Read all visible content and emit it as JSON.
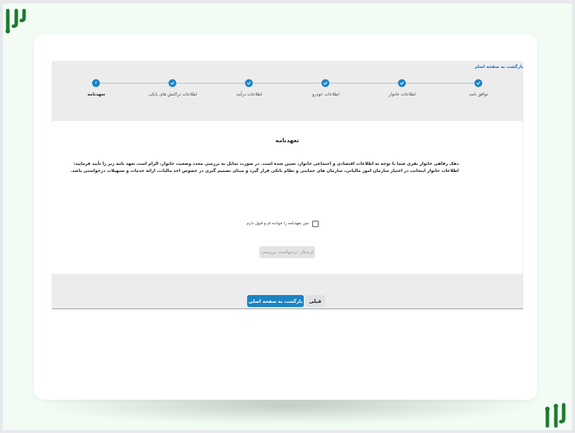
{
  "header": {
    "back_home_link": "بازگشت به صفحه اصلی"
  },
  "stepper": {
    "steps": [
      {
        "label": "توافق نامه",
        "state": "done"
      },
      {
        "label": "اطلاعات خانوار",
        "state": "done"
      },
      {
        "label": "اطلاعات خودرو",
        "state": "done"
      },
      {
        "label": "اطلاعات درآمد",
        "state": "done"
      },
      {
        "label": "اطلاعات تراکنش های بانکی",
        "state": "done"
      },
      {
        "label": "تعهدنامه",
        "state": "active",
        "number": "۶"
      }
    ]
  },
  "pledge": {
    "title": "تعهدنامه",
    "line1": "دهک رفاهی خانوار نفری شما با توجه به اطلاعات اقتصادی و اجتماعی خانوار، تعیین شده است. در صورت تمایل به بررسی مجدد وضعیت خانوار، الزام است تعهد نامه زیر را تأیید فرمایید:",
    "line2": "اطلاعات خانوار اینجانب در اختیار سازمان امور مالیاتی، سازمان های حمایتی و نظام بانکی قرار گیرد و مبنای تصمیم گیری در خصوص اخذ مالیات، ارائه خدمات و تسهیلات درخواستی باشد.",
    "checkbox_label": "متن تعهدنامه را خوانده ام و قبول دارم",
    "checkbox_checked": false,
    "submit_label": "ارسال درخواست بررسی"
  },
  "footer": {
    "home_button": "بازگشت به صفحه اصلی",
    "prev_button": "قبلی"
  },
  "colors": {
    "accent": "#1b84c4",
    "brand": "#1e7a2e",
    "background": "#eef9f0"
  }
}
